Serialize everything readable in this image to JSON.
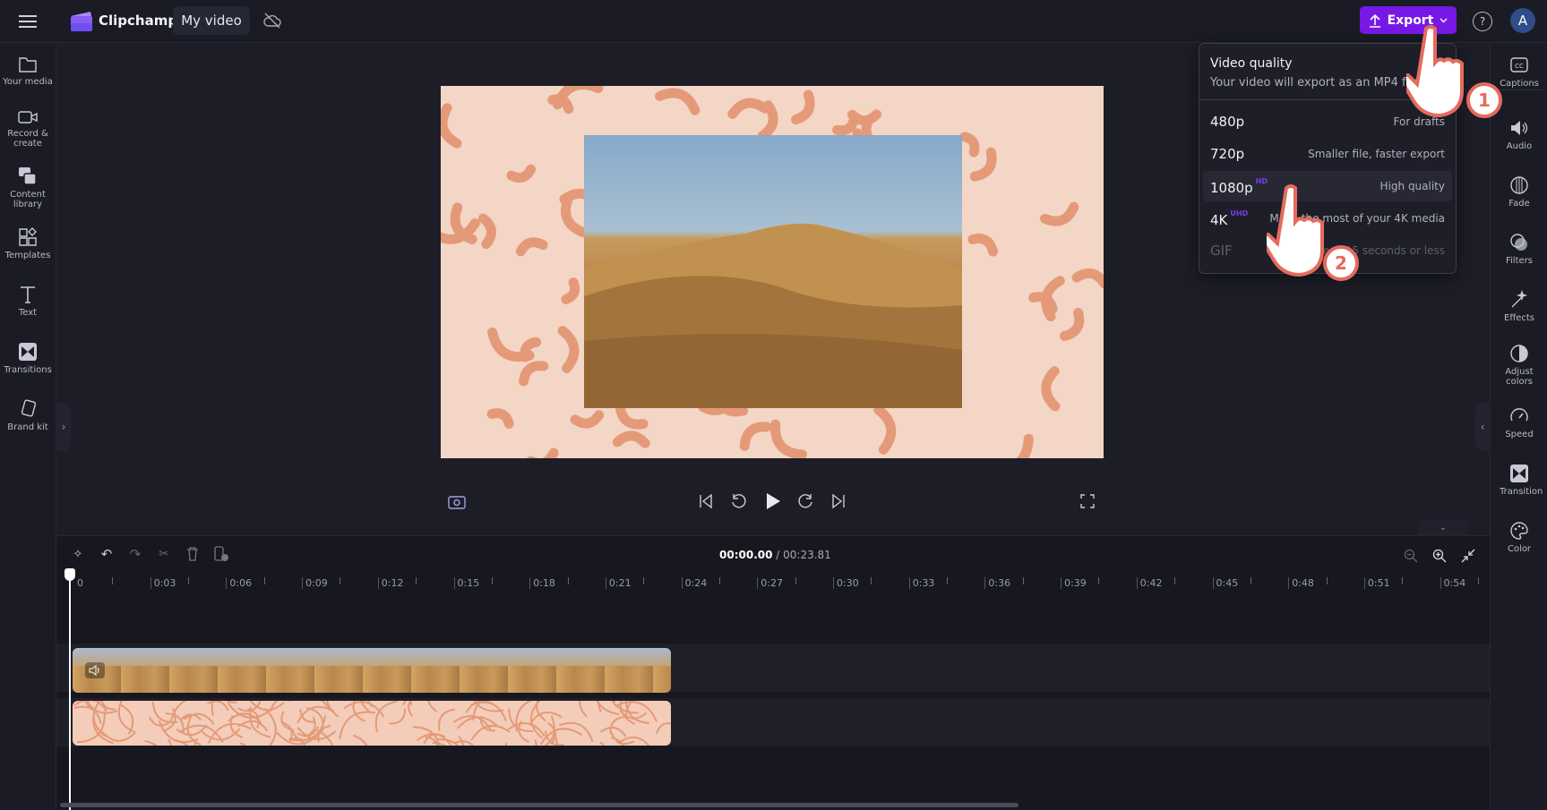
{
  "header": {
    "app_name": "Clipchamp",
    "project_title": "My video",
    "export_label": "Export",
    "avatar_initial": "A",
    "accent": "#7719e6"
  },
  "left_sidebar": {
    "items": [
      {
        "label": "Your media",
        "icon": "folder-icon"
      },
      {
        "label": "Record & create",
        "icon": "camera-icon"
      },
      {
        "label": "Content library",
        "icon": "content-library-icon"
      },
      {
        "label": "Templates",
        "icon": "templates-icon"
      },
      {
        "label": "Text",
        "icon": "text-icon"
      },
      {
        "label": "Transitions",
        "icon": "transitions-icon"
      },
      {
        "label": "Brand kit",
        "icon": "brand-kit-icon"
      }
    ]
  },
  "right_sidebar": {
    "items": [
      {
        "label": "Captions",
        "icon": "captions-icon"
      },
      {
        "label": "Audio",
        "icon": "audio-icon"
      },
      {
        "label": "Fade",
        "icon": "fade-icon"
      },
      {
        "label": "Filters",
        "icon": "filters-icon"
      },
      {
        "label": "Effects",
        "icon": "effects-icon"
      },
      {
        "label": "Adjust colors",
        "icon": "adjust-colors-icon"
      },
      {
        "label": "Speed",
        "icon": "speed-icon"
      },
      {
        "label": "Transition",
        "icon": "transition-icon"
      },
      {
        "label": "Color",
        "icon": "color-icon"
      }
    ]
  },
  "export_menu": {
    "title": "Video quality",
    "subtitle": "Your video will export as an MP4 file",
    "options": [
      {
        "name": "480p",
        "badge": "",
        "desc": "For drafts"
      },
      {
        "name": "720p",
        "badge": "",
        "desc": "Smaller file, faster export"
      },
      {
        "name": "1080p",
        "badge": "HD",
        "desc": "High quality",
        "highlighted": true
      },
      {
        "name": "4K",
        "badge": "UHD",
        "desc": "Make the most of your 4K media"
      },
      {
        "name": "GIF",
        "badge": "",
        "desc": "For videos 15 seconds or less",
        "disabled": true
      }
    ]
  },
  "annotations": {
    "step1": "1",
    "step2": "2"
  },
  "timeline": {
    "current_time": "00:00.00",
    "separator": " / ",
    "duration": "00:23.81",
    "ruler_labels": [
      "0",
      "0:03",
      "0:06",
      "0:09",
      "0:12",
      "0:15",
      "0:18",
      "0:21",
      "0:24",
      "0:27",
      "0:30",
      "0:33",
      "0:36",
      "0:39",
      "0:42",
      "0:45",
      "0:48",
      "0:51",
      "0:54"
    ]
  }
}
